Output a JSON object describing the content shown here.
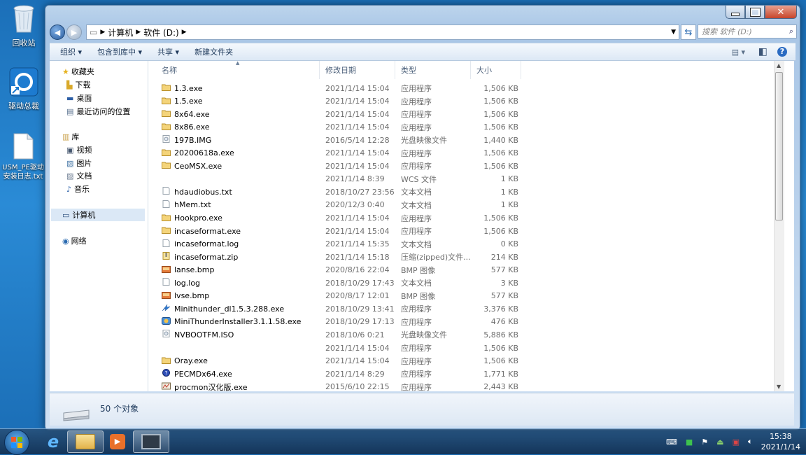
{
  "desktop": {
    "icons": [
      {
        "label": "回收站"
      },
      {
        "label": "驱动总裁"
      },
      {
        "label": "USM_PE驱动安装日志.txt"
      }
    ]
  },
  "window": {
    "address": {
      "crumbs": [
        "计算机",
        "软件 (D:)"
      ],
      "search_placeholder": "搜索 软件 (D:)"
    },
    "toolbar": {
      "organize": "组织",
      "include_library": "包含到库中",
      "share": "共享",
      "new_folder": "新建文件夹"
    },
    "nav": {
      "favorites": "收藏夹",
      "downloads": "下载",
      "desktop": "桌面",
      "recent": "最近访问的位置",
      "libraries": "库",
      "videos": "视频",
      "pictures": "图片",
      "documents": "文档",
      "music": "音乐",
      "computer": "计算机",
      "network": "网络"
    },
    "columns": {
      "name": "名称",
      "date": "修改日期",
      "type": "类型",
      "size": "大小"
    },
    "files": [
      {
        "name": "1.3.exe",
        "date": "2021/1/14 15:04",
        "type": "应用程序",
        "size": "1,506 KB",
        "icon": "folder-icon"
      },
      {
        "name": "1.5.exe",
        "date": "2021/1/14 15:04",
        "type": "应用程序",
        "size": "1,506 KB",
        "icon": "folder-icon"
      },
      {
        "name": "8x64.exe",
        "date": "2021/1/14 15:04",
        "type": "应用程序",
        "size": "1,506 KB",
        "icon": "folder-icon"
      },
      {
        "name": "8x86.exe",
        "date": "2021/1/14 15:04",
        "type": "应用程序",
        "size": "1,506 KB",
        "icon": "folder-icon"
      },
      {
        "name": "197B.IMG",
        "date": "2016/5/14 12:28",
        "type": "光盘映像文件",
        "size": "1,440 KB",
        "icon": "disc-image-icon"
      },
      {
        "name": "20200618a.exe",
        "date": "2021/1/14 15:04",
        "type": "应用程序",
        "size": "1,506 KB",
        "icon": "folder-icon"
      },
      {
        "name": "CeoMSX.exe",
        "date": "2021/1/14 15:04",
        "type": "应用程序",
        "size": "1,506 KB",
        "icon": "folder-icon"
      },
      {
        "name": "",
        "date": "2021/1/14 8:39",
        "type": "WCS 文件",
        "size": "1 KB",
        "icon": "none"
      },
      {
        "name": "hdaudiobus.txt",
        "date": "2018/10/27 23:56",
        "type": "文本文档",
        "size": "1 KB",
        "icon": "text-file-icon"
      },
      {
        "name": "hMem.txt",
        "date": "2020/12/3 0:40",
        "type": "文本文档",
        "size": "1 KB",
        "icon": "text-file-icon"
      },
      {
        "name": "Hookpro.exe",
        "date": "2021/1/14 15:04",
        "type": "应用程序",
        "size": "1,506 KB",
        "icon": "folder-icon"
      },
      {
        "name": "incaseformat.exe",
        "date": "2021/1/14 15:04",
        "type": "应用程序",
        "size": "1,506 KB",
        "icon": "folder-icon"
      },
      {
        "name": "incaseformat.log",
        "date": "2021/1/14 15:35",
        "type": "文本文档",
        "size": "0 KB",
        "icon": "text-file-icon"
      },
      {
        "name": "incaseformat.zip",
        "date": "2021/1/14 15:18",
        "type": "压缩(zipped)文件...",
        "size": "214 KB",
        "icon": "zip-icon"
      },
      {
        "name": "lanse.bmp",
        "date": "2020/8/16 22:04",
        "type": "BMP 图像",
        "size": "577 KB",
        "icon": "bitmap-icon"
      },
      {
        "name": "log.log",
        "date": "2018/10/29 17:43",
        "type": "文本文档",
        "size": "3 KB",
        "icon": "text-file-icon"
      },
      {
        "name": "lvse.bmp",
        "date": "2020/8/17 12:01",
        "type": "BMP 图像",
        "size": "577 KB",
        "icon": "bitmap-icon"
      },
      {
        "name": "Minithunder_dl1.5.3.288.exe",
        "date": "2018/10/29 13:41",
        "type": "应用程序",
        "size": "3,376 KB",
        "icon": "thunder-icon"
      },
      {
        "name": "MiniThunderInstaller3.1.1.58.exe",
        "date": "2018/10/29 17:13",
        "type": "应用程序",
        "size": "476 KB",
        "icon": "installer-icon"
      },
      {
        "name": "NVBOOTFM.ISO",
        "date": "2018/10/6 0:21",
        "type": "光盘映像文件",
        "size": "5,886 KB",
        "icon": "disc-image-icon"
      },
      {
        "name": "",
        "date": "2021/1/14 15:04",
        "type": "应用程序",
        "size": "1,506 KB",
        "icon": "none"
      },
      {
        "name": "Oray.exe",
        "date": "2021/1/14 15:04",
        "type": "应用程序",
        "size": "1,506 KB",
        "icon": "folder-icon"
      },
      {
        "name": "PECMDx64.exe",
        "date": "2021/1/14 8:29",
        "type": "应用程序",
        "size": "1,771 KB",
        "icon": "pecmd-icon"
      },
      {
        "name": "procmon汉化版.exe",
        "date": "2015/6/10 22:15",
        "type": "应用程序",
        "size": "2,443 KB",
        "icon": "procmon-icon"
      }
    ],
    "status": {
      "count": "50 个对象"
    }
  },
  "taskbar": {
    "time": "15:38",
    "date": "2021/1/14"
  }
}
